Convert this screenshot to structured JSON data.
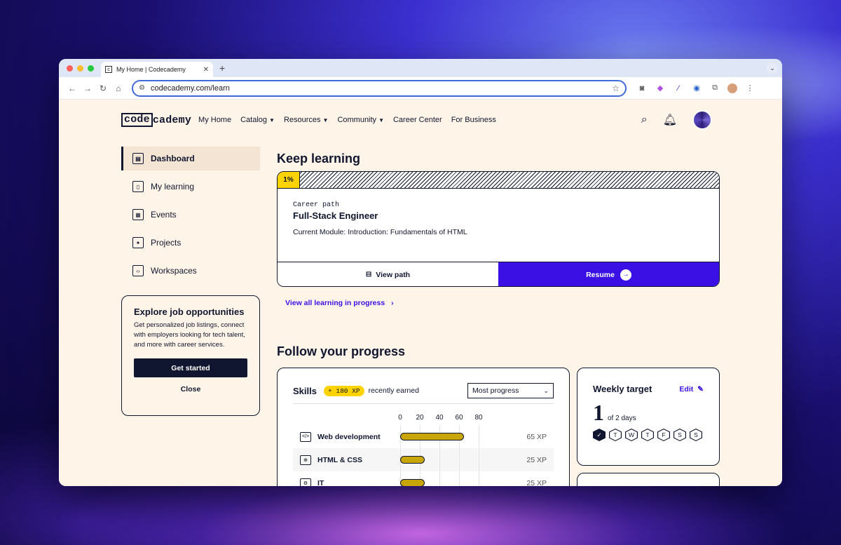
{
  "browser": {
    "tab_title": "My Home | Codecademy",
    "url": "codecademy.com/learn"
  },
  "header": {
    "logo_box": "code",
    "logo_rest": "cademy",
    "nav": [
      "My Home",
      "Catalog",
      "Resources",
      "Community",
      "Career Center",
      "For Business"
    ]
  },
  "sidebar": {
    "items": [
      {
        "label": "Dashboard",
        "icon": "dashboard-icon"
      },
      {
        "label": "My learning",
        "icon": "book-icon"
      },
      {
        "label": "Events",
        "icon": "calendar-icon"
      },
      {
        "label": "Projects",
        "icon": "puzzle-icon"
      },
      {
        "label": "Workspaces",
        "icon": "code-icon"
      }
    ],
    "job_card": {
      "title": "Explore job opportunities",
      "body": "Get personalized job listings, connect with employers looking for tech talent, and more with career services.",
      "cta": "Get started",
      "close": "Close"
    }
  },
  "keep_learning": {
    "heading": "Keep learning",
    "progress_badge": "1%",
    "progress": 0.01,
    "kicker": "Career path",
    "title": "Full-Stack Engineer",
    "module": "Current Module: Introduction: Fundamentals of HTML",
    "view_path": "View path",
    "resume": "Resume",
    "view_all": "View all learning in progress"
  },
  "progress": {
    "heading": "Follow your progress",
    "skills": {
      "title": "Skills",
      "xp_badge": "+ 180 XP",
      "recent": "recently earned",
      "sort_selected": "Most progress",
      "axis_ticks": [
        "0",
        "20",
        "40",
        "60",
        "80"
      ],
      "axis_max": 80,
      "rows": [
        {
          "name": "Web development",
          "xp": 65,
          "xp_label": "65 XP"
        },
        {
          "name": "HTML & CSS",
          "xp": 25,
          "xp_label": "25 XP"
        },
        {
          "name": "IT",
          "xp": 25,
          "xp_label": "25 XP"
        }
      ]
    },
    "weekly": {
      "title": "Weekly target",
      "edit": "Edit",
      "count": "1",
      "of_days": "of 2 days",
      "days": [
        {
          "label": "✓",
          "done": true
        },
        {
          "label": "T",
          "done": false
        },
        {
          "label": "W",
          "done": false
        },
        {
          "label": "T",
          "done": false
        },
        {
          "label": "F",
          "done": false
        },
        {
          "label": "S",
          "done": false
        },
        {
          "label": "S",
          "done": false
        }
      ]
    }
  },
  "colors": {
    "navy": "#10162f",
    "brand_purple": "#3a10e5",
    "yellow": "#ffd300",
    "beige": "#fff4e8"
  }
}
